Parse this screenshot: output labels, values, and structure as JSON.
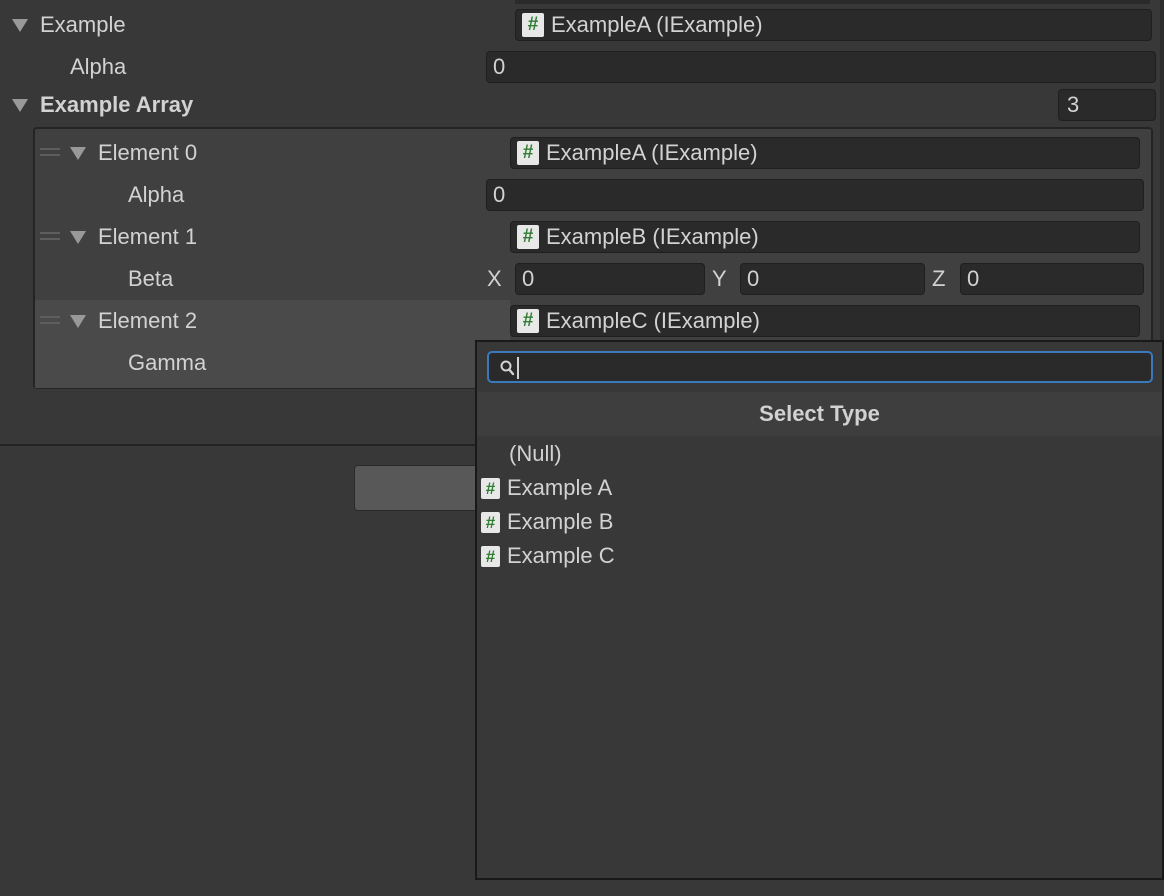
{
  "inspector": {
    "example": {
      "label": "Example",
      "type_value": "ExampleA (IExample)",
      "alpha_label": "Alpha",
      "alpha_value": "0"
    },
    "example_array": {
      "label": "Example Array",
      "size": "3",
      "elements": [
        {
          "label": "Element 0",
          "type_value": "ExampleA (IExample)",
          "field_label": "Alpha",
          "field_value": "0"
        },
        {
          "label": "Element 1",
          "type_value": "ExampleB (IExample)",
          "field_label": "Beta",
          "vector": {
            "x_label": "X",
            "x": "0",
            "y_label": "Y",
            "y": "0",
            "z_label": "Z",
            "z": "0"
          }
        },
        {
          "label": "Element 2",
          "type_value": "ExampleC (IExample)",
          "field_label": "Gamma"
        }
      ]
    }
  },
  "popup": {
    "search_value": "",
    "title": "Select Type",
    "items": [
      {
        "label": "(Null)",
        "icon": ""
      },
      {
        "label": "Example A",
        "icon": "#"
      },
      {
        "label": "Example B",
        "icon": "#"
      },
      {
        "label": "Example C",
        "icon": "#"
      }
    ]
  },
  "icons": {
    "script_glyph": "#"
  },
  "colors": {
    "background": "#383838",
    "field": "#2a2a2a",
    "accent_focus": "#3a79bb",
    "script_hash": "#2f7d32"
  }
}
